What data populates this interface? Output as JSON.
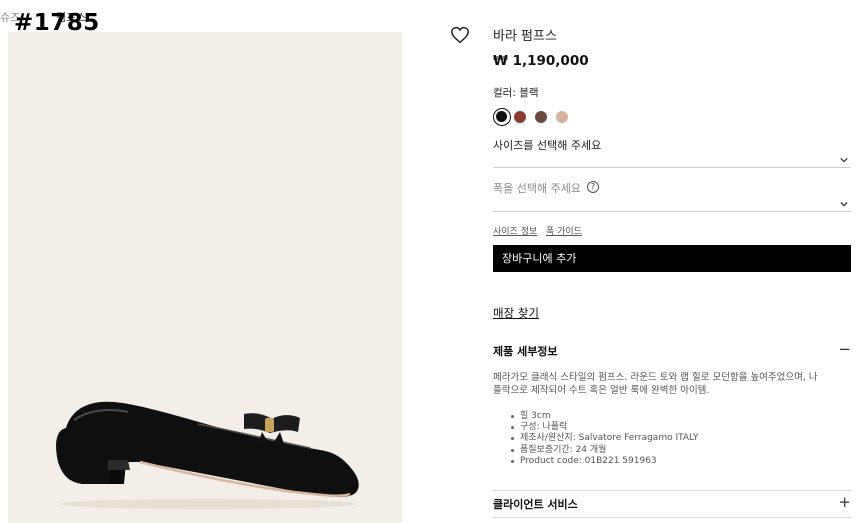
{
  "overlay_id": "#1785",
  "breadcrumb": [
    "슈즈",
    "펌프스"
  ],
  "product": {
    "title": "바라 펌프스",
    "price": "₩ 1,190,000",
    "color_label": "컬러: 블랙",
    "swatches": [
      {
        "name": "블랙",
        "hex": "#111111",
        "selected": true
      },
      {
        "name": "레드",
        "hex": "#8e3a2e",
        "selected": false
      },
      {
        "name": "브라운",
        "hex": "#6b4a3f",
        "selected": false
      },
      {
        "name": "누드",
        "hex": "#d6b39f",
        "selected": false
      }
    ],
    "size_select": "사이즈를 선택해 주세요",
    "width_select": "폭을 선택해 주세요",
    "width_help": "?",
    "size_info_link": "사이즈 정보",
    "width_guide_link": "폭 가이드",
    "add_to_cart": "장바구니에 추가",
    "store_finder": "매장 찾기"
  },
  "details": {
    "heading": "제품 세부정보",
    "toggle": "−",
    "description_line1": "페라가모 클래식 스타일의 펌프스. 라운드 토와 랩 힐로 모던함을 높여주었으며, 나",
    "description_line2": "플락으로 제작되어 수트 혹은 얼반 룩에 완벽한 아이템.",
    "specs": [
      "힐 3cm",
      "구성: 나플락",
      "제조사/원산지: Salvatore Ferragamo ITALY",
      "품질보증기간: 24 개월",
      "Product code: 01B221 591963"
    ]
  },
  "client_service": {
    "heading": "클라이언트 서비스",
    "toggle": "+"
  }
}
